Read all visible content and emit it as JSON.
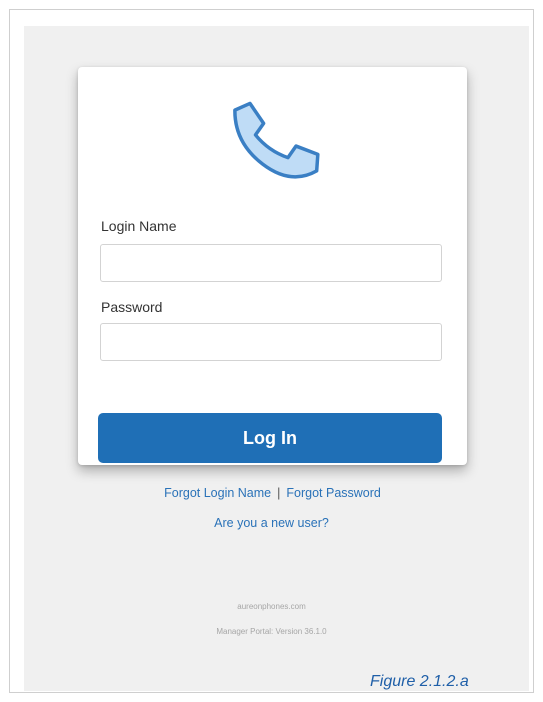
{
  "login": {
    "login_name_label": "Login Name",
    "login_name_value": "",
    "password_label": "Password",
    "password_value": "",
    "login_button": "Log In",
    "forgot_login_name": "Forgot Login Name",
    "separator": "|",
    "forgot_password": "Forgot Password"
  },
  "new_user_link": "Are you a new user?",
  "footer": {
    "domain": "aureonphones.com",
    "version": "Manager Portal: Version 36.1.0"
  },
  "caption": "Figure 2.1.2.a",
  "icons": {
    "logo": "phone-handset-icon"
  },
  "colors": {
    "primary": "#1f6fb6",
    "link": "#2a72b8",
    "icon_fill": "#bfdcf6",
    "icon_stroke": "#3a7fc4",
    "background": "#f0f0f0"
  }
}
